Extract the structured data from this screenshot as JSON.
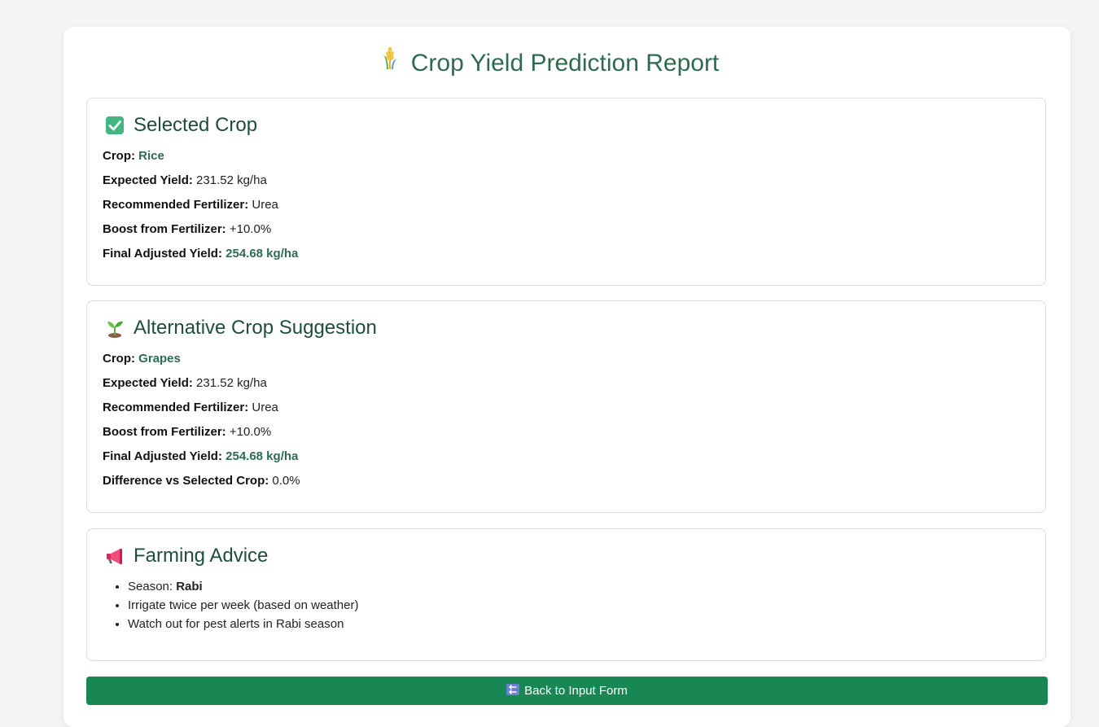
{
  "header": {
    "title": "Crop Yield Prediction Report",
    "icon": "wheat-icon"
  },
  "selected": {
    "heading": "Selected Crop",
    "icon": "check-box-icon",
    "rows": {
      "crop_label": "Crop:",
      "crop_value": "Rice",
      "yield_label": "Expected Yield:",
      "yield_value": "231.52 kg/ha",
      "fert_label": "Recommended Fertilizer:",
      "fert_value": "Urea",
      "boost_label": "Boost from Fertilizer:",
      "boost_value": "+10.0%",
      "final_label": "Final Adjusted Yield:",
      "final_value": "254.68 kg/ha"
    }
  },
  "alternative": {
    "heading": "Alternative Crop Suggestion",
    "icon": "seedling-icon",
    "rows": {
      "crop_label": "Crop:",
      "crop_value": "Grapes",
      "yield_label": "Expected Yield:",
      "yield_value": "231.52 kg/ha",
      "fert_label": "Recommended Fertilizer:",
      "fert_value": "Urea",
      "boost_label": "Boost from Fertilizer:",
      "boost_value": "+10.0%",
      "final_label": "Final Adjusted Yield:",
      "final_value": "254.68 kg/ha",
      "diff_label": "Difference vs Selected Crop:",
      "diff_value": "0.0%"
    }
  },
  "advice": {
    "heading": "Farming Advice",
    "icon": "megaphone-icon",
    "season_label": "Season:",
    "season_value": "Rabi",
    "items": [
      "Irrigate twice per week (based on weather)",
      "Watch out for pest alerts in Rabi season"
    ]
  },
  "button": {
    "label": "Back to Input Form",
    "icon": "back-arrow-icon"
  },
  "colors": {
    "accent": "#2e6b4f",
    "button": "#198754",
    "background": "#f5f5f5"
  }
}
